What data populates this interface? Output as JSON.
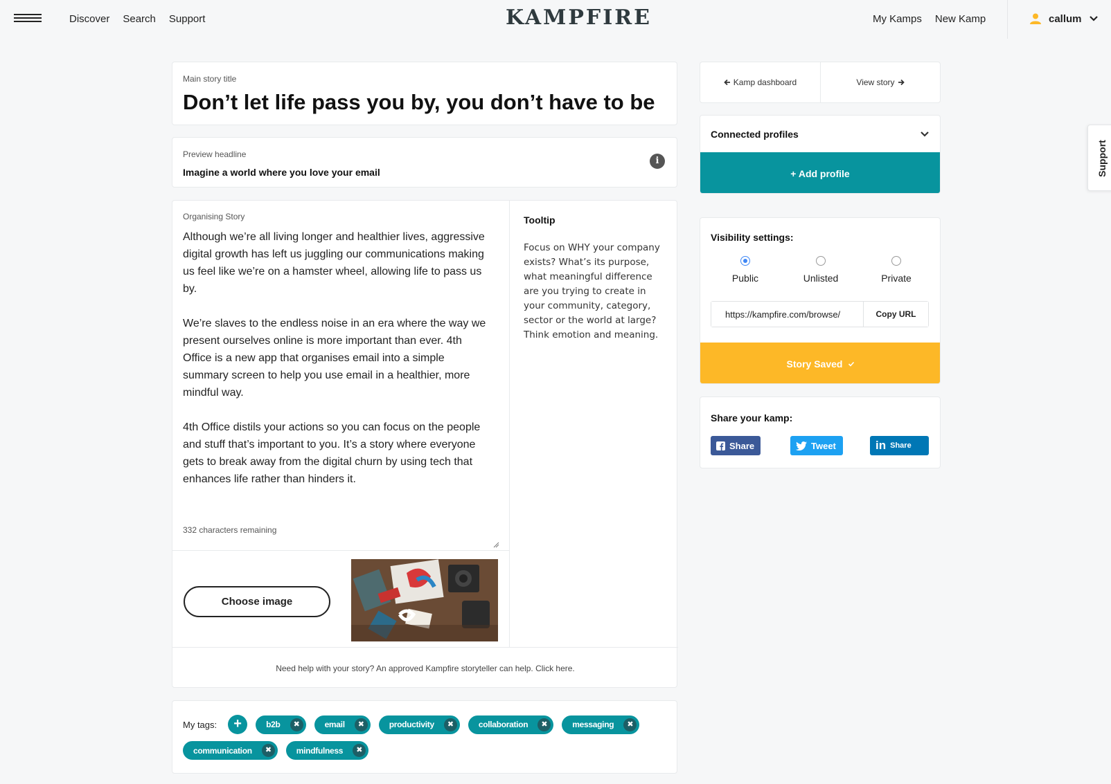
{
  "nav": {
    "left": [
      "Discover",
      "Search",
      "Support"
    ],
    "logo": "KAMPFIRE",
    "right": [
      "My Kamps",
      "New Kamp"
    ],
    "user": "callum"
  },
  "support_tab": "Support",
  "title_card": {
    "label": "Main story title",
    "title": "Don’t let life pass you by, you don’t have to be a"
  },
  "preview_card": {
    "label": "Preview headline",
    "headline": "Imagine a world where you love your email"
  },
  "story": {
    "label": "Organising Story",
    "paragraphs": [
      "Although we’re all living longer and healthier lives, aggressive digital growth has left us juggling our communications making us feel like we’re on a hamster wheel, allowing life to pass us by.",
      "We’re slaves to the endless noise in an era where the way we present ourselves online is more important than ever. 4th Office is a new app that organises email into a simple summary screen to help you use email in a healthier, more mindful way.",
      "4th Office distils your actions so you can focus on the people and stuff that’s important to you. It’s a story where everyone gets to break away from the digital churn by using tech that enhances life rather than hinders it."
    ],
    "chars_remaining": "332 characters remaining",
    "choose_image": "Choose image",
    "help_text": "Need help with your story? An approved Kampfire storyteller can help. Click here."
  },
  "tooltip": {
    "title": "Tooltip",
    "text": "Focus on WHY your company exists? What’s its purpose, what meaningful difference are you trying to create in your community, category, sector or the world at large? Think emotion and meaning."
  },
  "tags": {
    "label": "My tags:",
    "items": [
      "b2b",
      "email",
      "productivity",
      "collaboration",
      "messaging",
      "communication",
      "mindfulness"
    ]
  },
  "sidebar": {
    "kamp_dashboard": "Kamp dashboard",
    "view_story": "View story",
    "connected_profiles": "Connected profiles",
    "add_profile": "+ Add profile",
    "visibility_title": "Visibility settings:",
    "visibility_options": [
      "Public",
      "Unlisted",
      "Private"
    ],
    "visibility_selected": "Public",
    "url": "https://kampfire.com/browse/",
    "copy_url": "Copy URL",
    "story_saved": "Story Saved",
    "share_title": "Share your kamp:",
    "share_facebook": "Share",
    "share_twitter": "Tweet",
    "share_linkedin": "Share"
  },
  "colors": {
    "teal": "#08949e",
    "yellow": "#fdb827",
    "facebook": "#3b5998",
    "twitter": "#1da1f2",
    "linkedin": "#0077b5"
  }
}
